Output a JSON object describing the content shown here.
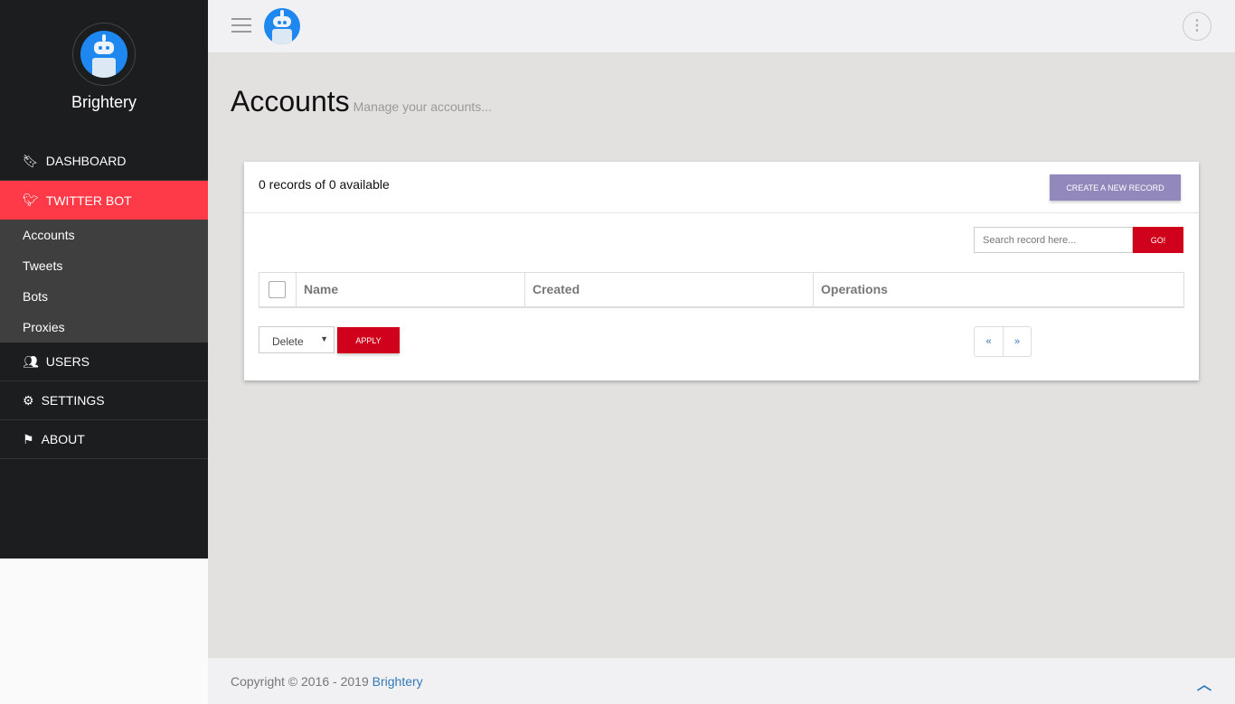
{
  "brand": "Brightery",
  "nav": {
    "dashboard": "DASHBOARD",
    "twitter_bot": "TWITTER BOT",
    "sub": [
      "Accounts",
      "Tweets",
      "Bots",
      "Proxies"
    ],
    "users": "USERS",
    "settings": "SETTINGS",
    "about": "ABOUT"
  },
  "page": {
    "title": "Accounts",
    "subtitle": "Manage your accounts..."
  },
  "card": {
    "count": "0 records of 0 available",
    "create": "CREATE A NEW RECORD",
    "search_placeholder": "Search record here...",
    "go": "GO!",
    "columns": [
      "Name",
      "Created",
      "Operations"
    ],
    "bulk_action": "Delete",
    "apply": "APPLY",
    "prev": "«",
    "next": "»"
  },
  "footer": {
    "text": "Copyright © 2016 - 2019 ",
    "link": "Brightery"
  }
}
